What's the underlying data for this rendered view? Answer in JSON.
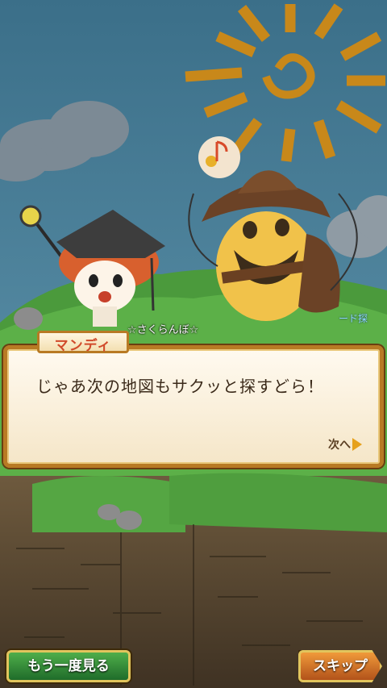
{
  "dialog": {
    "speaker": "マンディ",
    "text": "じゃあ次の地図もサクッと探すどら！",
    "next_label": "次へ"
  },
  "player": {
    "name": "☆さくらんぼ☆"
  },
  "other_character_name": "ード探",
  "buttons": {
    "replay_label": "もう一度見る",
    "skip_label": "スキップ"
  },
  "icons": [
    "sun-icon",
    "music-note-icon",
    "next-arrow-icon"
  ],
  "colors": {
    "frame": "#b87a24",
    "sky": "#4a7e98",
    "sun": "#c8881a",
    "replay_button": "#2e8a34",
    "skip_button": "#d8782a",
    "speaker_name": "#d14a2a"
  }
}
